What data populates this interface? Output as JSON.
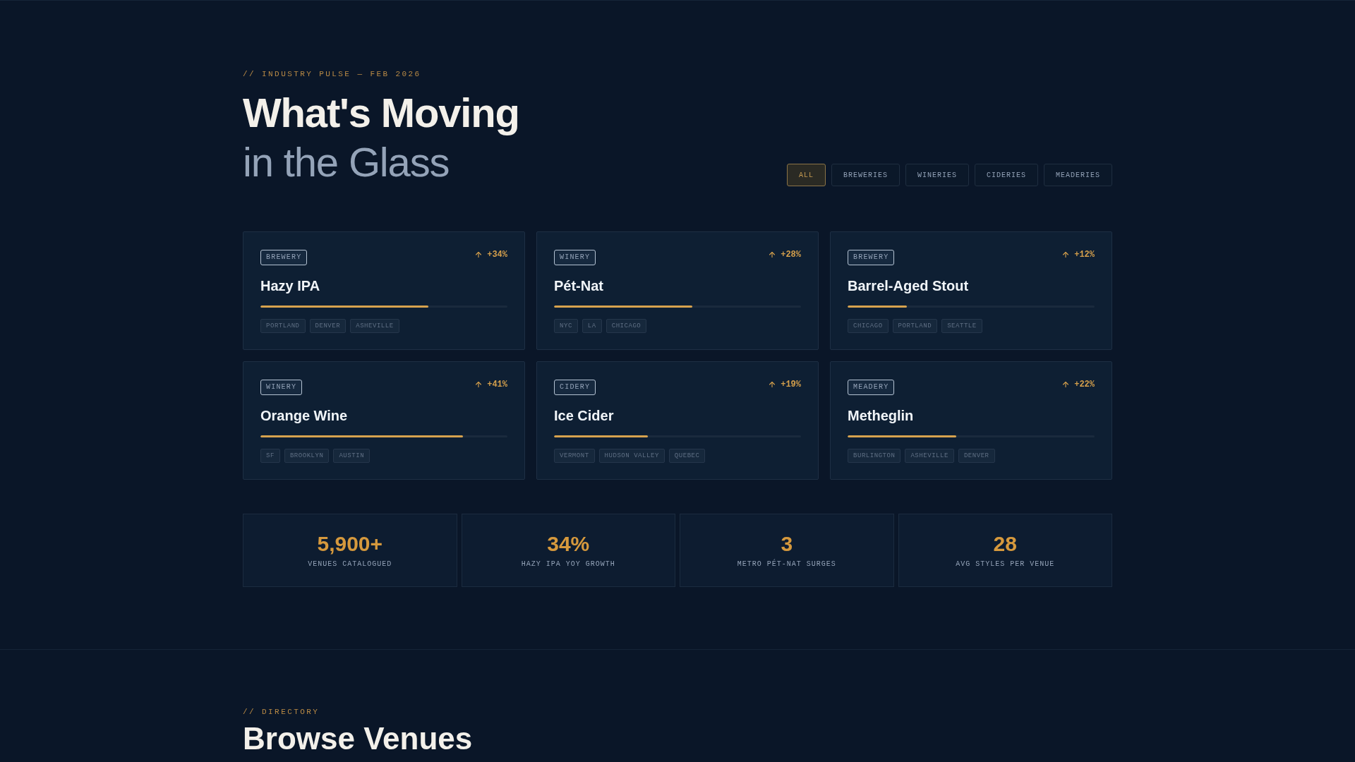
{
  "hero": {
    "eyebrow": "// INDUSTRY PULSE — FEB 2026",
    "title": "What's Moving",
    "subtitle": "in the Glass"
  },
  "filters": [
    {
      "label": "ALL",
      "selected": true
    },
    {
      "label": "BREWERIES",
      "selected": false
    },
    {
      "label": "WINERIES",
      "selected": false
    },
    {
      "label": "CIDERIES",
      "selected": false
    },
    {
      "label": "MEADERIES",
      "selected": false
    }
  ],
  "trends": [
    {
      "category": "BREWERY",
      "growth": "+34%",
      "name": "Hazy IPA",
      "level": 0.68,
      "cities": [
        "PORTLAND",
        "DENVER",
        "ASHEVILLE"
      ]
    },
    {
      "category": "WINERY",
      "growth": "+28%",
      "name": "Pét-Nat",
      "level": 0.56,
      "cities": [
        "NYC",
        "LA",
        "CHICAGO"
      ]
    },
    {
      "category": "BREWERY",
      "growth": "+12%",
      "name": "Barrel-Aged Stout",
      "level": 0.24,
      "cities": [
        "CHICAGO",
        "PORTLAND",
        "SEATTLE"
      ]
    },
    {
      "category": "WINERY",
      "growth": "+41%",
      "name": "Orange Wine",
      "level": 0.82,
      "cities": [
        "SF",
        "BROOKLYN",
        "AUSTIN"
      ]
    },
    {
      "category": "CIDERY",
      "growth": "+19%",
      "name": "Ice Cider",
      "level": 0.38,
      "cities": [
        "VERMONT",
        "HUDSON VALLEY",
        "QUEBEC"
      ]
    },
    {
      "category": "MEADERY",
      "growth": "+22%",
      "name": "Metheglin",
      "level": 0.44,
      "cities": [
        "BURLINGTON",
        "ASHEVILLE",
        "DENVER"
      ]
    }
  ],
  "stats": [
    {
      "value": "5,900+",
      "label": "VENUES CATALOGUED"
    },
    {
      "value": "34%",
      "label": "HAZY IPA YOY GROWTH"
    },
    {
      "value": "3",
      "label": "METRO PÉT-NAT SURGES"
    },
    {
      "value": "28",
      "label": "AVG STYLES PER VENUE"
    }
  ],
  "directory": {
    "eyebrow": "// DIRECTORY",
    "title": "Browse Venues"
  }
}
